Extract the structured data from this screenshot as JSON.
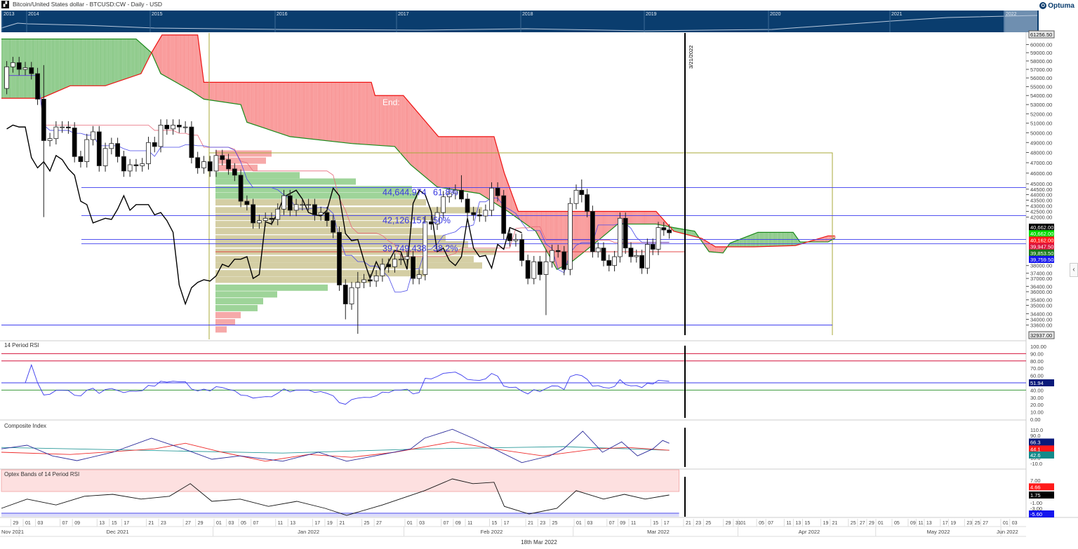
{
  "header": {
    "title": "Bitcoin/United States dollar - BTCUSD:CW - Daily - USD",
    "logo": "Optuma",
    "app_icon": "chart-icon"
  },
  "navigator": {
    "years": [
      "2013",
      "2014",
      "2015",
      "2016",
      "2017",
      "2018",
      "2019",
      "2020",
      "2021",
      "2022"
    ]
  },
  "footer": {
    "current_date": "18th Mar 2022"
  },
  "annotations": {
    "vertical_date_label": "3/21/2022",
    "end_label": "End:",
    "fib_levels": [
      {
        "value_label": "44,644.974",
        "pct_label": "61.8%",
        "price": 44644.974
      },
      {
        "value_label": "42,126.151",
        "pct_label": "50%",
        "price": 42126.151
      },
      {
        "value_label": "39,749.438",
        "pct_label": "38.2%",
        "price": 39749.438
      }
    ]
  },
  "panels": {
    "rsi_title": "14 Period RSI",
    "composite_title": "Composite Index",
    "optex_title": "Optex Bands of 14 Period RSI"
  },
  "colors": {
    "bull_candle": "#ffffff",
    "bear_candle": "#000000",
    "cloud_bull": "#8fcb8c",
    "cloud_bear": "#f99a9a",
    "tenkan": "#4a4ae8",
    "kijun": "#e86a7a",
    "chikou": "#000000",
    "nav_bg": "#0a3d6e"
  },
  "chart_data": {
    "type": "candlestick",
    "title": "Bitcoin/United States dollar - BTCUSD:CW - Daily - USD",
    "x_start_date": "2021-11-26",
    "date_index_origin": "2021-12-01",
    "first_open": 58900,
    "closes": [
      53600,
      54800,
      57300,
      57800,
      57000,
      57200,
      56500,
      53600,
      49200,
      49400,
      50600,
      50600,
      50500,
      47600,
      47100,
      49300,
      50100,
      46700,
      48400,
      48900,
      47600,
      46200,
      46800,
      46700,
      46900,
      49000,
      48600,
      50800,
      50400,
      50800,
      50600,
      50600,
      47500,
      46500,
      47100,
      46200,
      47700,
      47300,
      46400,
      45800,
      43400,
      43100,
      41500,
      41700,
      41900,
      41800,
      42700,
      43900,
      42600,
      43100,
      43100,
      43100,
      42200,
      42400,
      41700,
      40700,
      36500,
      35100,
      36300,
      36700,
      36900,
      36800,
      37200,
      38100,
      37900,
      38500,
      38500,
      38700,
      37000,
      37300,
      41600,
      41400,
      42400,
      43800,
      44100,
      44400,
      43600,
      42400,
      42200,
      42100,
      42600,
      44600,
      43900,
      40600,
      40000,
      40100,
      38400,
      37000,
      38300,
      37300,
      38300,
      39200,
      39100,
      37700,
      43200,
      44400,
      44000,
      42500,
      39100,
      39400,
      38400,
      38000,
      38700,
      41900,
      39400,
      38700,
      38800,
      37800,
      39700,
      39300,
      41100,
      40900,
      40662
    ],
    "wick_overrides": {
      "3": [
        57500,
        42000
      ],
      "52": [
        36800,
        34000
      ],
      "54": [
        37500,
        33000
      ],
      "71": [
        45800,
        43300
      ],
      "85": [
        39300,
        34300
      ],
      "91": [
        45400,
        43300
      ]
    },
    "price_axis": {
      "ticks": [
        60000,
        59000,
        58000,
        57000,
        56000,
        55000,
        54000,
        53000,
        52000,
        51000,
        50000,
        49000,
        48000,
        47000,
        46000,
        45000,
        44500,
        44000,
        43500,
        43000,
        42500,
        42000,
        38000,
        37400,
        37000,
        36400,
        36000,
        35400,
        35000,
        34400,
        34000,
        33600
      ],
      "high_label": "61256.50",
      "low_label": "32937.00",
      "badges": [
        {
          "label": "40,662.00",
          "bg": "#000000"
        },
        {
          "label": "40,662.00",
          "bg": "#00dd00"
        },
        {
          "label": "40,162.00",
          "bg": "#ff1a1a"
        },
        {
          "label": "39,947.50",
          "bg": "#dc143c"
        },
        {
          "label": "39,853.50",
          "bg": "#1a7a1a"
        },
        {
          "label": "39,759.50",
          "bg": "#1515ee"
        }
      ]
    },
    "cloud": {
      "span_a": [
        [
          -5,
          60700
        ],
        [
          18,
          60700
        ],
        [
          20.5,
          59000
        ],
        [
          22,
          56500
        ],
        [
          27,
          54500
        ],
        [
          29,
          53600
        ],
        [
          35,
          53000
        ],
        [
          36,
          51100
        ],
        [
          43,
          49600
        ],
        [
          53,
          48900
        ],
        [
          60,
          48600
        ],
        [
          62.6,
          46800
        ],
        [
          67,
          44700
        ],
        [
          74,
          44100
        ],
        [
          78.7,
          42500
        ],
        [
          83.3,
          40800
        ],
        [
          86.8,
          37700
        ],
        [
          89,
          38200
        ],
        [
          91.2,
          39000
        ],
        [
          93.7,
          39900
        ],
        [
          97.6,
          41400
        ],
        [
          104.6,
          41400
        ],
        [
          107.8,
          41100
        ],
        [
          111.8,
          40800
        ],
        [
          114.7,
          39100
        ],
        [
          117.5,
          39000
        ],
        [
          118.9,
          39800
        ],
        [
          124.8,
          40700
        ],
        [
          132.5,
          40700
        ],
        [
          134,
          39900
        ],
        [
          140.1,
          39900
        ],
        [
          141.6,
          40200
        ]
      ],
      "span_b": [
        [
          -5,
          53700
        ],
        [
          2.6,
          53700
        ],
        [
          7.3,
          55100
        ],
        [
          13,
          55100
        ],
        [
          18.8,
          56500
        ],
        [
          20.5,
          59000
        ],
        [
          22.2,
          61200
        ],
        [
          28,
          61200
        ],
        [
          29,
          55500
        ],
        [
          56.2,
          55500
        ],
        [
          56.8,
          54000
        ],
        [
          61.4,
          54000
        ],
        [
          67.2,
          49600
        ],
        [
          76.4,
          49600
        ],
        [
          78.1,
          46000
        ],
        [
          80.4,
          42500
        ],
        [
          104.6,
          42500
        ],
        [
          107.8,
          40800
        ],
        [
          113.2,
          40200
        ],
        [
          116,
          39500
        ],
        [
          124,
          39500
        ],
        [
          133,
          39600
        ],
        [
          140.1,
          40400
        ],
        [
          141.6,
          40400
        ]
      ]
    },
    "horizontal_levels": [
      44644.974,
      42126.151,
      39749.438,
      40100,
      33600
    ],
    "red_level": 39100,
    "volume_profile": [
      [
        47900,
        20,
        "r"
      ],
      [
        47200,
        18,
        "r"
      ],
      [
        46500,
        15,
        "r"
      ],
      [
        45800,
        30,
        "g"
      ],
      [
        45200,
        50,
        "g"
      ],
      [
        44500,
        70,
        "g"
      ],
      [
        43900,
        72,
        "g"
      ],
      [
        43300,
        75,
        "t"
      ],
      [
        42600,
        95,
        "t"
      ],
      [
        42000,
        80,
        "t"
      ],
      [
        41400,
        70,
        "t"
      ],
      [
        40800,
        75,
        "t"
      ],
      [
        40200,
        82,
        "t"
      ],
      [
        39700,
        90,
        "t"
      ],
      [
        39100,
        100,
        "t"
      ],
      [
        38500,
        92,
        "t"
      ],
      [
        38000,
        95,
        "t"
      ],
      [
        37400,
        75,
        "t"
      ],
      [
        36900,
        55,
        "t"
      ],
      [
        36300,
        40,
        "g"
      ],
      [
        35800,
        22,
        "g"
      ],
      [
        35300,
        17,
        "g"
      ],
      [
        34800,
        15,
        "g"
      ],
      [
        34300,
        9,
        "r"
      ],
      [
        33800,
        7,
        "r"
      ],
      [
        33300,
        4,
        "r"
      ]
    ],
    "rsi": {
      "ticks": [
        "100.00",
        "90.00",
        "80.00",
        "70.00",
        "60.00",
        "50.00",
        "40.00",
        "30.00",
        "20.00",
        "10.00",
        "0.00"
      ],
      "levels": [
        90,
        80,
        50,
        40
      ],
      "last_label": "51.94"
    },
    "composite": {
      "ticks": [
        [
          "110.0",
          110
        ],
        [
          "90.0",
          90
        ],
        [
          "10.0",
          10
        ],
        [
          "-10.0",
          -10
        ]
      ],
      "blue": [
        [
          -4.3,
          42
        ],
        [
          0.3,
          55
        ],
        [
          4.4,
          17
        ],
        [
          8.4,
          0
        ],
        [
          14.2,
          30
        ],
        [
          20.5,
          80
        ],
        [
          25.7,
          42
        ],
        [
          30.3,
          5
        ],
        [
          34.9,
          17
        ],
        [
          41.8,
          -2
        ],
        [
          47.6,
          30
        ],
        [
          52.2,
          -2
        ],
        [
          58,
          22
        ],
        [
          62.6,
          42
        ],
        [
          64.9,
          80
        ],
        [
          69.5,
          112
        ],
        [
          72.9,
          80
        ],
        [
          76.4,
          42
        ],
        [
          81,
          -7
        ],
        [
          85.6,
          17
        ],
        [
          87.9,
          42
        ],
        [
          91.2,
          105
        ],
        [
          94.8,
          30
        ],
        [
          98.3,
          67
        ],
        [
          101.2,
          17
        ],
        [
          104,
          42
        ],
        [
          105.8,
          72
        ],
        [
          107,
          62
        ]
      ],
      "red": [
        [
          -4.3,
          30
        ],
        [
          7.3,
          22
        ],
        [
          21,
          42
        ],
        [
          26,
          62
        ],
        [
          32,
          30
        ],
        [
          39,
          -2
        ],
        [
          46,
          22
        ],
        [
          53,
          12
        ],
        [
          60,
          30
        ],
        [
          69.5,
          67
        ],
        [
          76.4,
          42
        ],
        [
          84.5,
          17
        ],
        [
          93.7,
          42
        ],
        [
          99.5,
          47
        ],
        [
          107,
          37
        ]
      ],
      "teal": [
        [
          -4.3,
          47
        ],
        [
          18.8,
          37
        ],
        [
          41.8,
          27
        ],
        [
          64.9,
          42
        ],
        [
          87.9,
          50
        ],
        [
          107,
          37
        ]
      ],
      "badges": [
        {
          "label": "66.3",
          "bg": "#0a1a7a"
        },
        {
          "label": "44.1",
          "bg": "#ff1a1a"
        },
        {
          "label": "42.6",
          "bg": "#138a8a"
        }
      ]
    },
    "optex": {
      "ticks": [
        [
          "7.00",
          7
        ],
        [
          "-1.00",
          -1
        ],
        [
          "-3.00",
          -3
        ]
      ],
      "band_top": 9.0,
      "band_bottom": 3.0,
      "black": [
        [
          -4.3,
          -3
        ],
        [
          0.3,
          0.3
        ],
        [
          5,
          -1.8
        ],
        [
          9.6,
          1.3
        ],
        [
          14.2,
          2
        ],
        [
          18.8,
          0.3
        ],
        [
          23.4,
          1.3
        ],
        [
          26.8,
          5.8
        ],
        [
          30.3,
          -0.5
        ],
        [
          34.9,
          0.3
        ],
        [
          39.5,
          -2.3
        ],
        [
          44.1,
          -0.5
        ],
        [
          48.7,
          -3
        ],
        [
          52.2,
          -5.5
        ],
        [
          58,
          -1.8
        ],
        [
          64.9,
          3.3
        ],
        [
          69.5,
          7.5
        ],
        [
          72.9,
          5.8
        ],
        [
          76.4,
          6.3
        ],
        [
          78.1,
          -2.3
        ],
        [
          82.2,
          -5
        ],
        [
          86.8,
          -3
        ],
        [
          90,
          3.3
        ],
        [
          95,
          0.3
        ],
        [
          98.8,
          2
        ],
        [
          102.6,
          0.3
        ],
        [
          106.2,
          1.5
        ],
        [
          107,
          1.75
        ]
      ],
      "badges": [
        {
          "label": "4.66",
          "bg": "#ff1a1a"
        },
        {
          "label": "1.75",
          "bg": "#000000"
        },
        {
          "label": "-5.60",
          "bg": "#1515ee"
        }
      ]
    },
    "day_ticks": [
      [
        -2,
        "29"
      ],
      [
        0,
        "01"
      ],
      [
        2,
        "03"
      ],
      [
        6,
        "07"
      ],
      [
        8,
        "09"
      ],
      [
        12,
        "13"
      ],
      [
        14,
        "15"
      ],
      [
        16,
        "17"
      ],
      [
        20,
        "21"
      ],
      [
        22,
        "23"
      ],
      [
        26,
        "27"
      ],
      [
        28,
        "29"
      ],
      [
        31,
        "01"
      ],
      [
        33,
        "03"
      ],
      [
        35,
        "05"
      ],
      [
        37,
        "07"
      ],
      [
        41,
        "11"
      ],
      [
        43,
        "13"
      ],
      [
        47,
        "17"
      ],
      [
        49,
        "19"
      ],
      [
        51,
        "21"
      ],
      [
        55,
        "25"
      ],
      [
        57,
        "27"
      ],
      [
        62,
        "01"
      ],
      [
        64,
        "03"
      ],
      [
        68,
        "07"
      ],
      [
        70,
        "09"
      ],
      [
        72,
        "11"
      ],
      [
        76,
        "15"
      ],
      [
        78,
        "17"
      ],
      [
        82,
        "21"
      ],
      [
        84,
        "23"
      ],
      [
        86,
        "25"
      ],
      [
        90,
        "01"
      ],
      [
        92,
        "03"
      ],
      [
        96,
        "07"
      ],
      [
        98,
        "09"
      ],
      [
        100,
        "11"
      ],
      [
        104,
        "15"
      ],
      [
        106,
        "17"
      ],
      [
        110,
        "21"
      ],
      [
        112,
        "23"
      ],
      [
        114,
        "25"
      ],
      [
        118,
        "29"
      ],
      [
        120,
        "31"
      ],
      [
        121,
        "01"
      ],
      [
        125,
        "05"
      ],
      [
        127,
        "07"
      ],
      [
        131,
        "11"
      ],
      [
        133,
        "13"
      ],
      [
        135,
        "15"
      ],
      [
        139,
        "19"
      ],
      [
        141,
        "21"
      ],
      [
        145,
        "25"
      ],
      [
        147,
        "27"
      ],
      [
        149,
        "29"
      ],
      [
        151,
        "01"
      ],
      [
        155,
        "05"
      ],
      [
        159,
        "09"
      ],
      [
        161,
        "11"
      ],
      [
        163,
        "13"
      ],
      [
        167,
        "17"
      ],
      [
        169,
        "19"
      ],
      [
        173,
        "23"
      ],
      [
        175,
        "25"
      ],
      [
        177,
        "27"
      ],
      [
        182,
        "01"
      ],
      [
        184,
        "03"
      ]
    ],
    "month_labels": [
      [
        -4,
        "Nov 2021"
      ],
      [
        15,
        "Dec 2021"
      ],
      [
        46,
        "Jan 2022"
      ],
      [
        76,
        "Feb 2022"
      ],
      [
        105,
        "Mar 2022"
      ],
      [
        136,
        "Apr 2022"
      ],
      [
        166,
        "May 2022"
      ],
      [
        183,
        "Jun 2022"
      ]
    ],
    "month_bounds": [
      -1,
      30.5,
      61.5,
      89.5,
      120.5,
      150.5,
      181.5
    ]
  }
}
